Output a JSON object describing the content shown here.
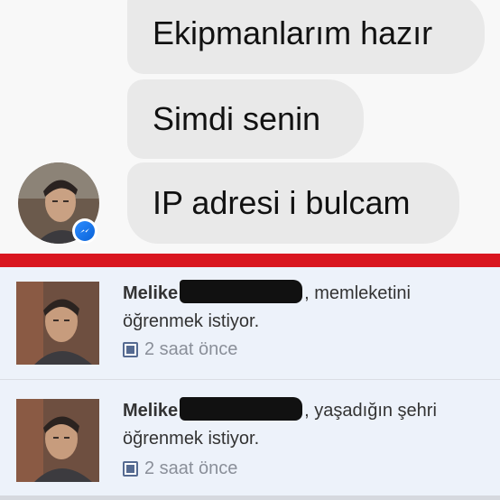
{
  "chat": {
    "messages": [
      {
        "text": "Ekipmanlarım hazır"
      },
      {
        "text": "Simdi senin"
      },
      {
        "text": "IP adresi i bulcam"
      }
    ],
    "avatar_icon": "profile-photo",
    "badge_icon": "messenger-icon",
    "badge_color": "#0a63d8"
  },
  "divider_color": "#d9161f",
  "notifications": [
    {
      "name": "Melike",
      "text_after": ", memleketini öğrenmek istiyor.",
      "time": "2 saat önce",
      "time_icon": "page-icon"
    },
    {
      "name": "Melike",
      "text_after": ", yaşadığın şehri öğrenmek istiyor.",
      "time": "2 saat önce",
      "time_icon": "page-icon"
    }
  ]
}
